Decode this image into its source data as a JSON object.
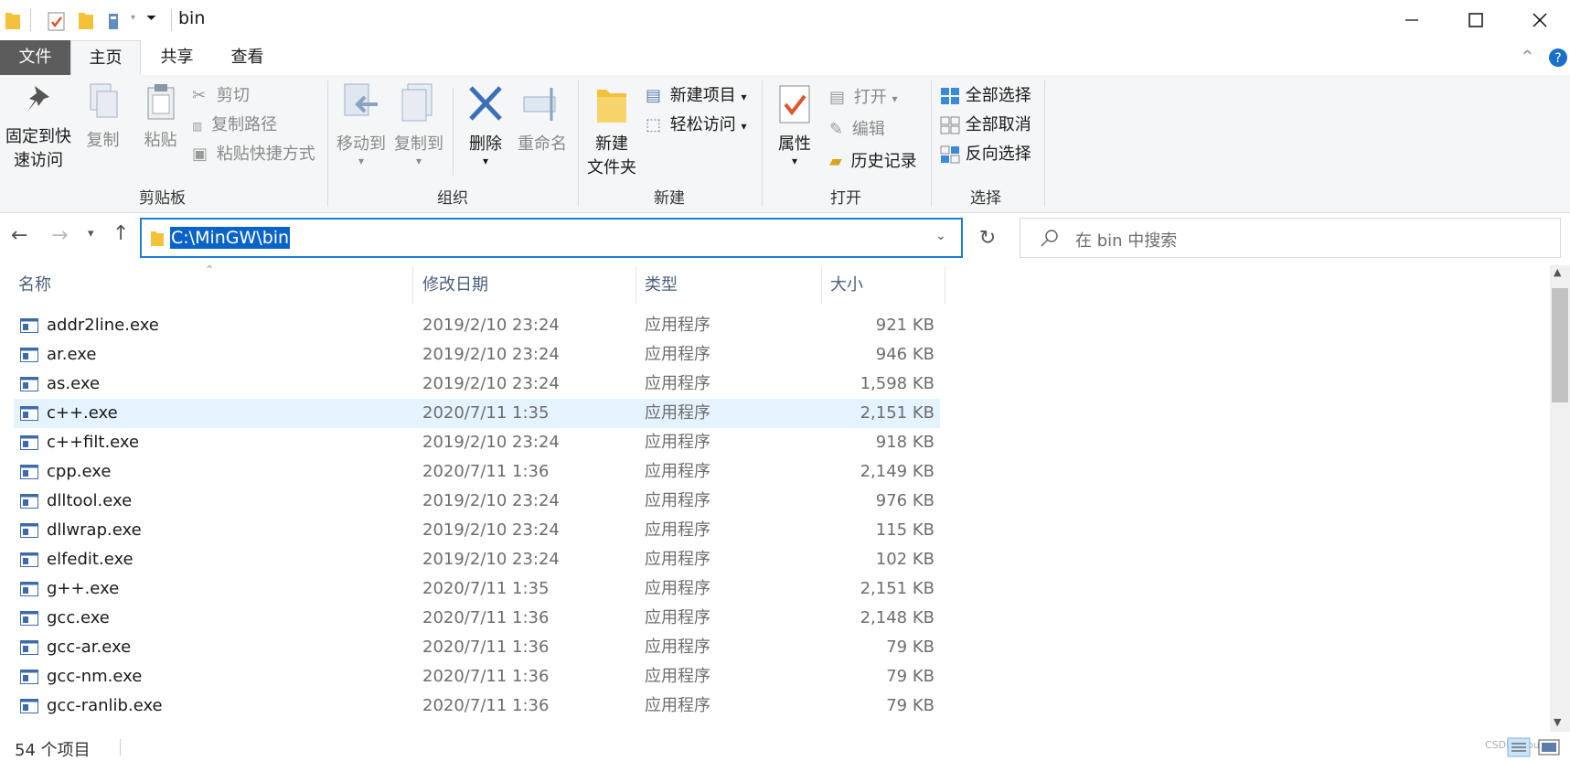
{
  "window": {
    "title": "bin"
  },
  "tabs": [
    {
      "label": "文件"
    },
    {
      "label": "主页"
    },
    {
      "label": "共享"
    },
    {
      "label": "查看"
    }
  ],
  "ribbon": {
    "clipboard": {
      "pin_label_1": "固定到快",
      "pin_label_2": "速访问",
      "copy": "复制",
      "paste": "粘贴",
      "cut": "剪切",
      "copy_path": "复制路径",
      "paste_shortcut": "粘贴快捷方式",
      "group": "剪贴板"
    },
    "organize": {
      "move_to": "移动到",
      "copy_to": "复制到",
      "delete": "删除",
      "rename": "重命名",
      "group": "组织"
    },
    "new": {
      "new_folder_1": "新建",
      "new_folder_2": "文件夹",
      "new_item": "新建项目",
      "easy_access": "轻松访问",
      "group": "新建"
    },
    "open": {
      "properties": "属性",
      "open": "打开",
      "edit": "编辑",
      "history": "历史记录",
      "group": "打开"
    },
    "select": {
      "select_all": "全部选择",
      "select_none": "全部取消",
      "invert": "反向选择",
      "group": "选择"
    }
  },
  "address": {
    "path": "C:\\MinGW\\bin",
    "search_placeholder": "在 bin 中搜索"
  },
  "columns": {
    "name": "名称",
    "date": "修改日期",
    "type": "类型",
    "size": "大小"
  },
  "files": [
    {
      "name": "addr2line.exe",
      "date": "2019/2/10 23:24",
      "type": "应用程序",
      "size": "921 KB"
    },
    {
      "name": "ar.exe",
      "date": "2019/2/10 23:24",
      "type": "应用程序",
      "size": "946 KB"
    },
    {
      "name": "as.exe",
      "date": "2019/2/10 23:24",
      "type": "应用程序",
      "size": "1,598 KB"
    },
    {
      "name": "c++.exe",
      "date": "2020/7/11 1:35",
      "type": "应用程序",
      "size": "2,151 KB"
    },
    {
      "name": "c++filt.exe",
      "date": "2019/2/10 23:24",
      "type": "应用程序",
      "size": "918 KB"
    },
    {
      "name": "cpp.exe",
      "date": "2020/7/11 1:36",
      "type": "应用程序",
      "size": "2,149 KB"
    },
    {
      "name": "dlltool.exe",
      "date": "2019/2/10 23:24",
      "type": "应用程序",
      "size": "976 KB"
    },
    {
      "name": "dllwrap.exe",
      "date": "2019/2/10 23:24",
      "type": "应用程序",
      "size": "115 KB"
    },
    {
      "name": "elfedit.exe",
      "date": "2019/2/10 23:24",
      "type": "应用程序",
      "size": "102 KB"
    },
    {
      "name": "g++.exe",
      "date": "2020/7/11 1:35",
      "type": "应用程序",
      "size": "2,151 KB"
    },
    {
      "name": "gcc.exe",
      "date": "2020/7/11 1:36",
      "type": "应用程序",
      "size": "2,148 KB"
    },
    {
      "name": "gcc-ar.exe",
      "date": "2020/7/11 1:36",
      "type": "应用程序",
      "size": "79 KB"
    },
    {
      "name": "gcc-nm.exe",
      "date": "2020/7/11 1:36",
      "type": "应用程序",
      "size": "79 KB"
    },
    {
      "name": "gcc-ranlib.exe",
      "date": "2020/7/11 1:36",
      "type": "应用程序",
      "size": "79 KB"
    }
  ],
  "status": {
    "count": "54 个项目"
  },
  "watermark": "CSDN @bukoo"
}
